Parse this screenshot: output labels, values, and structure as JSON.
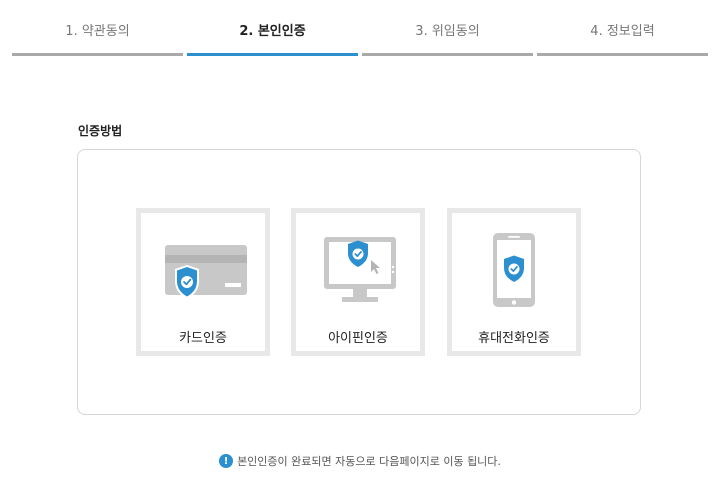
{
  "steps": [
    {
      "label": "1. 약관동의",
      "active": false
    },
    {
      "label": "2. 본인인증",
      "active": true
    },
    {
      "label": "3. 위임동의",
      "active": false
    },
    {
      "label": "4. 정보입력",
      "active": false
    }
  ],
  "section": {
    "title": "인증방법"
  },
  "methods": [
    {
      "label": "카드인증",
      "icon": "card-shield-icon"
    },
    {
      "label": "아이핀인증",
      "icon": "monitor-shield-icon"
    },
    {
      "label": "휴대전화인증",
      "icon": "phone-shield-icon"
    }
  ],
  "notice": {
    "icon": "exclamation-icon",
    "text": "본인인증이 완료되면 자동으로 다음페이지로 이동 됩니다."
  },
  "colors": {
    "accent": "#2b8fd0",
    "inactive_bar": "#a9a9a9",
    "icon_gray": "#c8c8c8",
    "option_border": "#e8e8e8"
  }
}
